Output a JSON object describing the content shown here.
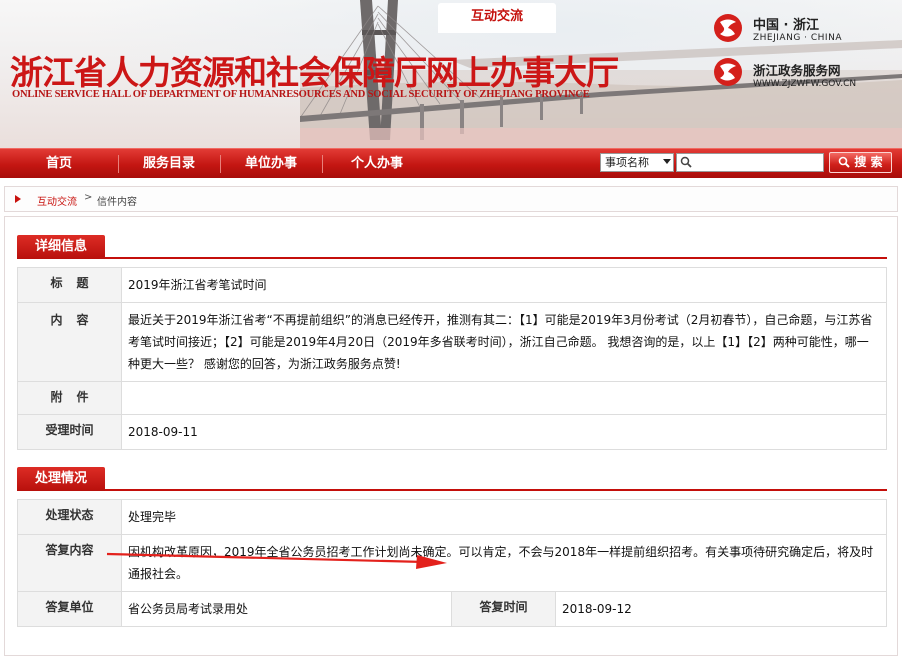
{
  "header": {
    "site_title": "浙江省人力资源和社会保障厅网上办事大厅",
    "site_subtitle": "ONLINE SERVICE HALL OF DEPARTMENT OF HUMANRESOURCES AND SOCIAL SECURITY OF ZHEJIANG PROVINCE",
    "logo1_title": "中国 · 浙江",
    "logo1_sub": "ZHEJIANG · CHINA",
    "logo2_title": "浙江政务服务网",
    "logo2_sub": "WWW.ZJZWFW.GOV.CN"
  },
  "nav": {
    "items": [
      "首页",
      "服务目录",
      "单位办事",
      "个人办事"
    ],
    "active": "互动交流",
    "search_select": "事项名称",
    "search_button": "搜 索"
  },
  "breadcrumb": {
    "link": "互动交流",
    "separator": ">",
    "current": "信件内容"
  },
  "details": {
    "section_title": "详细信息",
    "title_label": "标题",
    "title_value": "2019年浙江省考笔试时间",
    "content_label": "内容",
    "content_value": "最近关于2019年浙江省考“不再提前组织”的消息已经传开，推测有其二：【1】可能是2019年3月份考试（2月初春节），自己命题，与江苏省考笔试时间接近；【2】可能是2019年4月20日（2019年多省联考时间），浙江自己命题。 我想咨询的是，以上【1】【2】两种可能性，哪一种更大一些？ 感谢您的回答，为浙江政务服务点赞!",
    "attachment_label": "附件",
    "attachment_value": "",
    "accept_time_label": "受理时间",
    "accept_time_value": "2018-09-11"
  },
  "processing": {
    "section_title": "处理情况",
    "status_label": "处理状态",
    "status_value": "处理完毕",
    "reply_label": "答复内容",
    "reply_value": "因机构改革原因，2019年全省公务员招考工作计划尚未确定。可以肯定，不会与2018年一样提前组织招考。有关事项待研究确定后，将及时通报社会。",
    "unit_label": "答复单位",
    "unit_value": "省公务员局考试录用处",
    "reply_time_label": "答复时间",
    "reply_time_value": "2018-09-12"
  },
  "colors": {
    "brand_red": "#c40f0b",
    "label_bg": "#f3f3f3",
    "annotation_arrow": "#e3211c"
  }
}
